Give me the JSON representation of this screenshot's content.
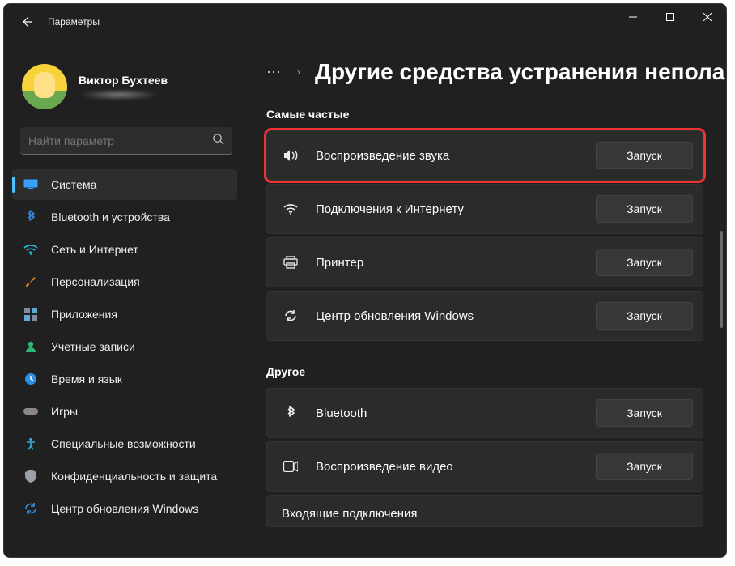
{
  "window": {
    "title": "Параметры"
  },
  "profile": {
    "name": "Виктор Бухтеев"
  },
  "search": {
    "placeholder": "Найти параметр"
  },
  "nav": [
    {
      "id": "system",
      "label": "Система",
      "icon": "monitor",
      "color": "#3aa0ff",
      "active": true
    },
    {
      "id": "bluetooth",
      "label": "Bluetooth и устройства",
      "icon": "bluetooth",
      "color": "#3a8dde",
      "active": false
    },
    {
      "id": "network",
      "label": "Сеть и Интернет",
      "icon": "wifi",
      "color": "#22c3e6",
      "active": false
    },
    {
      "id": "personal",
      "label": "Персонализация",
      "icon": "brush",
      "color": "#e67e22",
      "active": false
    },
    {
      "id": "apps",
      "label": "Приложения",
      "icon": "apps",
      "color": "#7e8ba3",
      "active": false
    },
    {
      "id": "accounts",
      "label": "Учетные записи",
      "icon": "person",
      "color": "#2fb574",
      "active": false
    },
    {
      "id": "time",
      "label": "Время и язык",
      "icon": "clock",
      "color": "#2f8fe0",
      "active": false
    },
    {
      "id": "gaming",
      "label": "Игры",
      "icon": "gamepad",
      "color": "#b5b5b5",
      "active": false
    },
    {
      "id": "access",
      "label": "Специальные возможности",
      "icon": "access",
      "color": "#2fb0e0",
      "active": false
    },
    {
      "id": "privacy",
      "label": "Конфиденциальность и защита",
      "icon": "shield",
      "color": "#9aa0a6",
      "active": false
    },
    {
      "id": "update",
      "label": "Центр обновления Windows",
      "icon": "sync",
      "color": "#2f8fe0",
      "active": false
    }
  ],
  "breadcrumb": {
    "ellipsis": "⋯",
    "chevron": "›"
  },
  "page": {
    "title": "Другие средства устранения непола"
  },
  "sections": {
    "frequent": {
      "title": "Самые частые",
      "items": [
        {
          "id": "audio",
          "label": "Воспроизведение звука",
          "icon": "speaker",
          "button": "Запуск",
          "highlight": true
        },
        {
          "id": "internet",
          "label": "Подключения к Интернету",
          "icon": "wifi",
          "button": "Запуск",
          "highlight": false
        },
        {
          "id": "printer",
          "label": "Принтер",
          "icon": "printer",
          "button": "Запуск",
          "highlight": false
        },
        {
          "id": "wupdate",
          "label": "Центр обновления Windows",
          "icon": "sync",
          "button": "Запуск",
          "highlight": false
        }
      ]
    },
    "other": {
      "title": "Другое",
      "items": [
        {
          "id": "bt",
          "label": "Bluetooth",
          "icon": "bluetooth",
          "button": "Запуск",
          "highlight": false
        },
        {
          "id": "video",
          "label": "Воспроизведение видео",
          "icon": "video",
          "button": "Запуск",
          "highlight": false
        },
        {
          "id": "incoming",
          "label": "Входящие подключения",
          "icon": "",
          "button": "",
          "highlight": false,
          "partial": true
        }
      ]
    }
  }
}
